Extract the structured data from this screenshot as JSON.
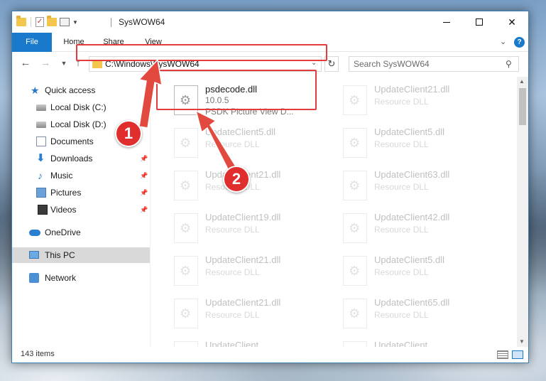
{
  "window": {
    "title": "SysWOW64",
    "minimize_label": "",
    "maximize_label": "",
    "close_label": "✕"
  },
  "ribbon": {
    "tabs": [
      "File",
      "Home",
      "Share",
      "View"
    ]
  },
  "address_bar": {
    "path": "C:\\Windows\\SysWOW64"
  },
  "search": {
    "placeholder": "Search SysWOW64"
  },
  "sidebar": {
    "items": [
      {
        "label": "Quick access",
        "icon": "quick-access-star-icon"
      },
      {
        "label": "Local Disk (C:)",
        "icon": "disk-icon"
      },
      {
        "label": "Local Disk (D:)",
        "icon": "disk-icon"
      },
      {
        "label": "Documents",
        "icon": "documents-icon"
      },
      {
        "label": "Downloads",
        "icon": "downloads-icon",
        "pinned": true
      },
      {
        "label": "Music",
        "icon": "music-icon",
        "pinned": true
      },
      {
        "label": "Pictures",
        "icon": "pictures-icon",
        "pinned": true
      },
      {
        "label": "Videos",
        "icon": "videos-icon",
        "pinned": true
      },
      {
        "label": "OneDrive",
        "icon": "onedrive-icon"
      },
      {
        "label": "This PC",
        "icon": "this-pc-icon",
        "selected": true
      },
      {
        "label": "Network",
        "icon": "network-icon"
      }
    ]
  },
  "files": {
    "highlighted": {
      "name": "psdecode.dll",
      "version": "10.0.5",
      "description": "PSDK Picture View D..."
    },
    "left_column": [
      {
        "name": "UpdateClient5.dll",
        "type": "Resource DLL"
      },
      {
        "name": "UpdateClient21.dll",
        "type": "Resource DLL"
      },
      {
        "name": "UpdateClient19.dll",
        "type": "Resource DLL"
      },
      {
        "name": "UpdateClient21.dll",
        "type": "Resource DLL"
      },
      {
        "name": "UpdateClient21.dll",
        "type": "Resource DLL"
      },
      {
        "name": "UpdateClient...",
        "type": ""
      }
    ],
    "right_column": [
      {
        "name": "UpdateClient21.dll",
        "type": "Resource DLL"
      },
      {
        "name": "UpdateClient5.dll",
        "type": "Resource DLL"
      },
      {
        "name": "UpdateClient63.dll",
        "type": "Resource DLL"
      },
      {
        "name": "UpdateClient42.dll",
        "type": "Resource DLL"
      },
      {
        "name": "UpdateClient5.dll",
        "type": "Resource DLL"
      },
      {
        "name": "UpdateClient65.dll",
        "type": "Resource DLL"
      },
      {
        "name": "UpdateClient...",
        "type": ""
      }
    ]
  },
  "status": {
    "item_count": "143 items"
  },
  "callouts": {
    "one": "1",
    "two": "2"
  },
  "colors": {
    "accent": "#1979ca",
    "highlight": "#e23c3c",
    "callout": "#e02e2e"
  }
}
